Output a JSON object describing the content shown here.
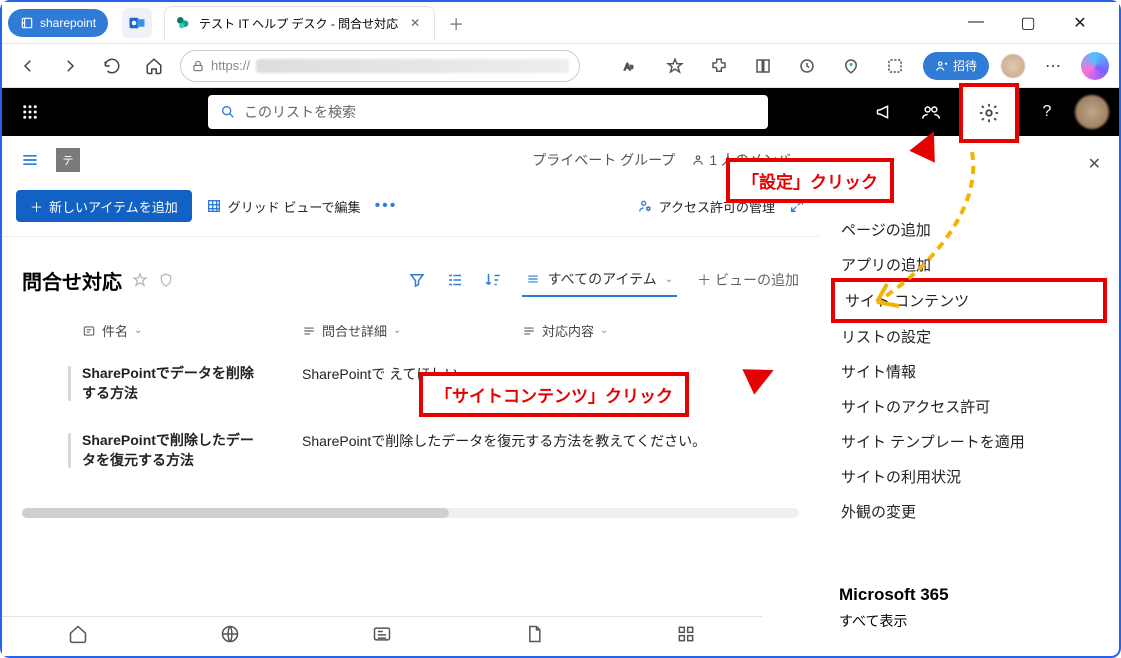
{
  "browser": {
    "pinned_label": "sharepoint",
    "tab_title": "テスト IT ヘルプ デスク - 問合せ対応",
    "url_scheme": "https://",
    "invite_label": "招待"
  },
  "suite": {
    "search_placeholder": "このリストを検索"
  },
  "site": {
    "logo_letter": "テ",
    "group_type": "プライベート グループ",
    "members": "1 人のメンバー"
  },
  "cmd": {
    "new_item": "新しいアイテムを追加",
    "grid_edit": "グリッド ビューで編集",
    "manage_access": "アクセス許可の管理"
  },
  "list": {
    "title": "問合せ対応",
    "view_label": "すべてのアイテム",
    "add_view": "ビューの追加",
    "columns": {
      "title": "件名",
      "detail": "問合せ詳細",
      "response": "対応内容"
    },
    "rows": [
      {
        "title": "SharePointでデータを削除する方法",
        "detail": "SharePointで\nえてほしい"
      },
      {
        "title": "SharePointで削除したデータを復元する方法",
        "detail": "SharePointで削除したデータを復元する方法を教えてください。"
      }
    ]
  },
  "settings_panel": {
    "items": [
      "ページの追加",
      "アプリの追加",
      "サイト コンテンツ",
      "リストの設定",
      "サイト情報",
      "サイトのアクセス許可",
      "サイト テンプレートを適用",
      "サイトの利用状況",
      "外観の変更"
    ],
    "m365_title": "Microsoft 365",
    "m365_link": "すべて表示"
  },
  "callouts": {
    "settings": "「設定」クリック",
    "site_contents": "「サイトコンテンツ」クリック"
  }
}
